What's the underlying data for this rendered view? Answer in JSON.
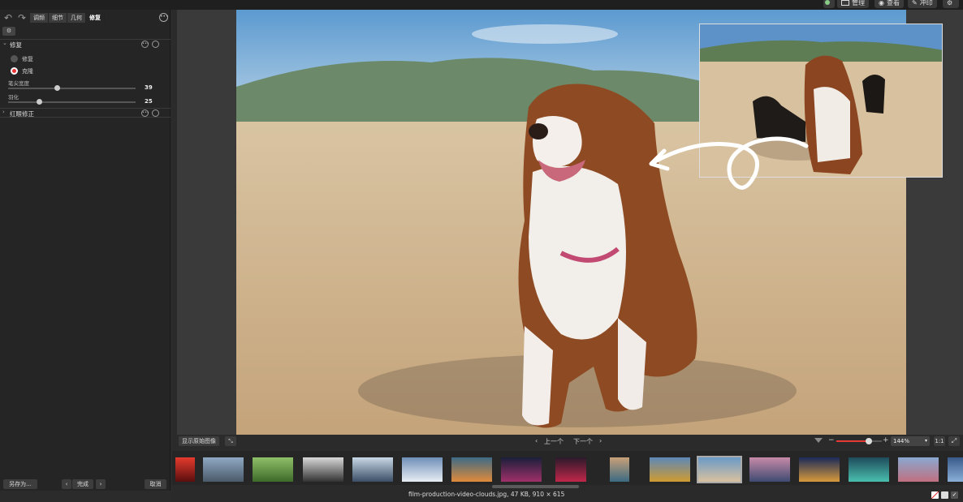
{
  "toolbar": {
    "tabs": [
      "调频",
      "细节",
      "几何",
      "修复"
    ],
    "right_buttons": [
      "管理",
      "查看",
      "冲印"
    ]
  },
  "left_panel": {
    "repair_section": {
      "title": "修复",
      "modes": [
        {
          "label": "修复",
          "selected": false
        },
        {
          "label": "克隆",
          "selected": true
        }
      ],
      "sliders": [
        {
          "label": "笔尖宽度",
          "value": "39",
          "fraction": 0.38
        },
        {
          "label": "羽化",
          "value": "25",
          "fraction": 0.24
        }
      ]
    },
    "redeye_section": {
      "title": "红眼修正"
    },
    "footer": {
      "save_as": "另存为...",
      "done": "完成",
      "cancel": "取消"
    }
  },
  "viewer": {
    "show_original": "显示原始图像",
    "prev": "上一个",
    "next": "下一个",
    "zoom": "144%",
    "zoom_level": 0.72,
    "one_to_one": "1:1"
  },
  "status": {
    "filename_info": "film-production-video-clouds.jpg, 47 KB, 910 × 615"
  },
  "colors": {
    "accent_red": "#e53935",
    "panel_bg": "#252525",
    "app_bg": "#2b2b2b"
  }
}
